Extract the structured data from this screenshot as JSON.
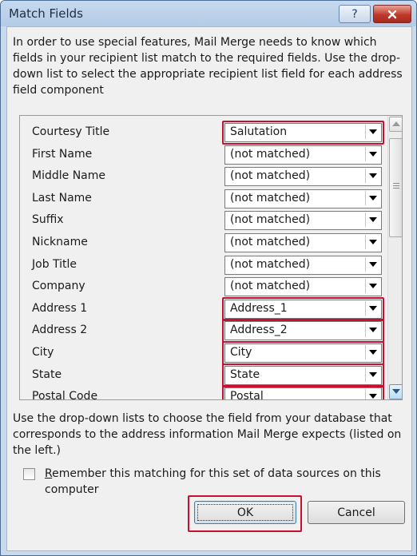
{
  "window": {
    "title": "Match Fields",
    "help_symbol": "?",
    "close_symbol": "✕"
  },
  "intro_text": "In order to use special features, Mail Merge needs to know which fields in your recipient list match to the required fields.  Use the drop-down list to select the appropriate recipient list field for each address field component",
  "fields": [
    {
      "label": "Courtesy Title",
      "value": "Salutation",
      "highlighted": true
    },
    {
      "label": "First Name",
      "value": "(not matched)",
      "highlighted": false
    },
    {
      "label": "Middle Name",
      "value": "(not matched)",
      "highlighted": false
    },
    {
      "label": "Last Name",
      "value": "(not matched)",
      "highlighted": false
    },
    {
      "label": "Suffix",
      "value": "(not matched)",
      "highlighted": false
    },
    {
      "label": "Nickname",
      "value": "(not matched)",
      "highlighted": false
    },
    {
      "label": "Job Title",
      "value": "(not matched)",
      "highlighted": false
    },
    {
      "label": "Company",
      "value": "(not matched)",
      "highlighted": false
    },
    {
      "label": "Address 1",
      "value": "Address_1",
      "highlighted": true
    },
    {
      "label": "Address 2",
      "value": "Address_2",
      "highlighted": true
    },
    {
      "label": "City",
      "value": "City",
      "highlighted": true
    },
    {
      "label": "State",
      "value": "State",
      "highlighted": true
    },
    {
      "label": "Postal Code",
      "value": "Postal",
      "highlighted": true
    }
  ],
  "help_text": "Use the drop-down lists to choose the field from your database that corresponds to the address information Mail Merge expects (listed on the left.)",
  "remember": {
    "label": "Remember this matching for this set of data sources on this computer",
    "checked": false
  },
  "buttons": {
    "ok_label": "OK",
    "cancel_label": "Cancel"
  },
  "colors": {
    "highlight": "#c8102e",
    "title_bar": "#b3cbe6",
    "close_button": "#c0392b"
  }
}
